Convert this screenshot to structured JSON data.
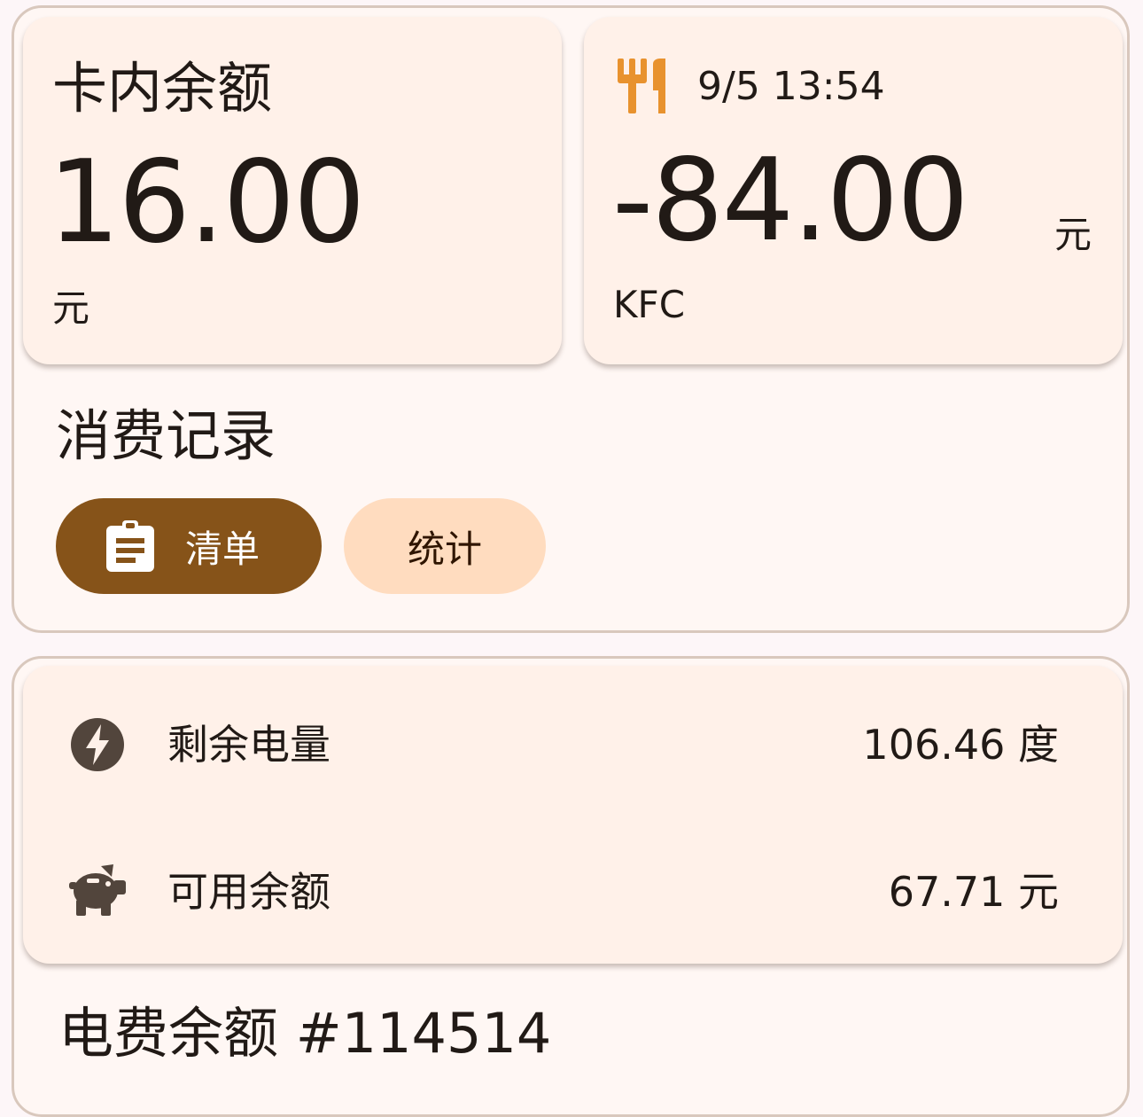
{
  "card_balance": {
    "label": "卡内余额",
    "amount": "16.00",
    "unit": "元"
  },
  "last_transaction": {
    "icon": "restaurant-icon",
    "time": "9/5 13:54",
    "amount": "-84.00",
    "unit": "元",
    "merchant": "KFC"
  },
  "consumption": {
    "title": "消费记录",
    "list_label": "清单",
    "list_icon": "clipboard-icon",
    "stats_label": "统计"
  },
  "electricity": {
    "rows": [
      {
        "icon": "bolt-icon",
        "label": "剩余电量",
        "value": "106.46 度"
      },
      {
        "icon": "piggy-bank-icon",
        "label": "可用余额",
        "value": "67.71 元"
      }
    ],
    "title": "电费余额 #114514"
  },
  "colors": {
    "accent": "#865319",
    "tonal": "#ffdcbf",
    "icon_orange": "#e8922e",
    "icon_dark": "#52453c"
  }
}
